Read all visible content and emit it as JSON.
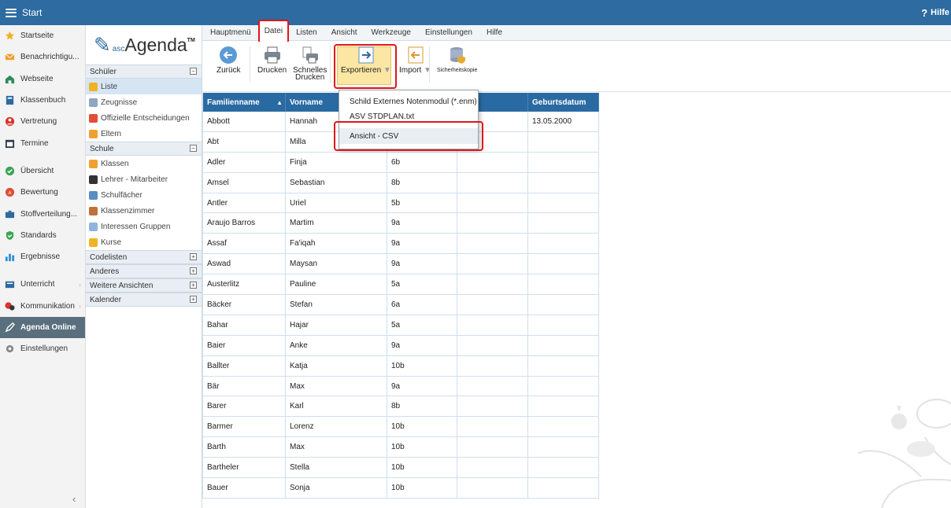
{
  "topbar": {
    "title": "Start",
    "help": "Hilfe"
  },
  "leftnav": {
    "items": [
      {
        "label": "Startseite",
        "icon": "star-icon",
        "color": "#f0b323"
      },
      {
        "label": "Benachrichtigu...",
        "icon": "mail-icon",
        "color": "#f0a030"
      },
      {
        "label": "Webseite",
        "icon": "house-icon",
        "color": "#2e8b57"
      },
      {
        "label": "Klassenbuch",
        "icon": "book-icon",
        "color": "#2d6ba1"
      },
      {
        "label": "Vertretung",
        "icon": "person-icon",
        "color": "#d9342b"
      },
      {
        "label": "Termine",
        "icon": "calendar-icon",
        "color": "#2d3e50"
      },
      {
        "label": "Übersicht",
        "icon": "check-circle-icon",
        "color": "#3aa655"
      },
      {
        "label": "Bewertung",
        "icon": "grade-icon",
        "color": "#e04e39"
      },
      {
        "label": "Stoffverteilung...",
        "icon": "briefcase-icon",
        "color": "#2d6ba1"
      },
      {
        "label": "Standards",
        "icon": "shield-icon",
        "color": "#3aa655"
      },
      {
        "label": "Ergebnisse",
        "icon": "bar-chart-icon",
        "color": "#2d8fd5"
      },
      {
        "label": "Unterricht",
        "icon": "class-icon",
        "color": "#2d6ba1"
      },
      {
        "label": "Kommunikation",
        "icon": "chat-icon",
        "color": "#d9342b"
      },
      {
        "label": "Agenda Online",
        "icon": "pen-icon",
        "color": "#ffffff"
      },
      {
        "label": "Einstellungen",
        "icon": "gear-icon",
        "color": "#888888"
      }
    ]
  },
  "sidebar": {
    "logo": {
      "prefix": "asc",
      "name": "Agenda",
      "tm": "TM"
    },
    "sections": [
      {
        "title": "Schüler",
        "state": "−",
        "items": [
          "Liste",
          "Zeugnisse",
          "Offizielle Entscheidungen",
          "Eltern"
        ]
      },
      {
        "title": "Schule",
        "state": "−",
        "items": [
          "Klassen",
          "Lehrer - Mitarbeiter",
          "Schulfächer",
          "Klassenzimmer",
          "Interessen Gruppen",
          "Kurse"
        ]
      },
      {
        "title": "Codelisten",
        "state": "+"
      },
      {
        "title": "Anderes",
        "state": "+"
      },
      {
        "title": "Weitere Ansichten",
        "state": "+"
      },
      {
        "title": "Kalender",
        "state": "+"
      }
    ]
  },
  "menubar": [
    "Hauptmenü",
    "Datei",
    "Listen",
    "Ansicht",
    "Werkzeuge",
    "Einstellungen",
    "Hilfe"
  ],
  "toolbar": {
    "back": "Zurück",
    "print": "Drucken",
    "quick_print_1": "Schnelles",
    "quick_print_2": "Drucken",
    "export": "Exportieren",
    "import": "Import",
    "backup": "Sicherheitskopie"
  },
  "dropdown": {
    "items": [
      "Schild Externes Notenmodul (*.enm)",
      "ASV STDPLAN.txt",
      "Ansicht - CSV"
    ]
  },
  "table": {
    "headers": [
      "Familienname",
      "Vorname",
      "",
      "",
      "Geburtsdatum"
    ],
    "sort_indicator": "▲",
    "rows": [
      [
        "Abbott",
        "Hannah",
        "",
        "",
        "13.05.2000"
      ],
      [
        "Abt",
        "Milla",
        "",
        "",
        ""
      ],
      [
        "Adler",
        "Finja",
        "6b",
        "",
        ""
      ],
      [
        "Amsel",
        "Sebastian",
        "8b",
        "",
        ""
      ],
      [
        "Antler",
        "Uriel",
        "5b",
        "",
        ""
      ],
      [
        "Araujo Barros",
        "Martim",
        "9a",
        "",
        ""
      ],
      [
        "Assaf",
        "Fa'iqah",
        "9a",
        "",
        ""
      ],
      [
        "Aswad",
        "Maysan",
        "9a",
        "",
        ""
      ],
      [
        "Austerlitz",
        "Pauline",
        "5a",
        "",
        ""
      ],
      [
        "Bäcker",
        "Stefan",
        "6a",
        "",
        ""
      ],
      [
        "Bahar",
        "Hajar",
        "5a",
        "",
        ""
      ],
      [
        "Baier",
        "Anke",
        "9a",
        "",
        ""
      ],
      [
        "Ballter",
        "Katja",
        "10b",
        "",
        ""
      ],
      [
        "Bär",
        "Max",
        "9a",
        "",
        ""
      ],
      [
        "Barer",
        "Karl",
        "8b",
        "",
        ""
      ],
      [
        "Barmer",
        "Lorenz",
        "10b",
        "",
        ""
      ],
      [
        "Barth",
        "Max",
        "10b",
        "",
        ""
      ],
      [
        "Bartheler",
        "Stella",
        "10b",
        "",
        ""
      ],
      [
        "Bauer",
        "Sonja",
        "10b",
        "",
        ""
      ]
    ]
  }
}
